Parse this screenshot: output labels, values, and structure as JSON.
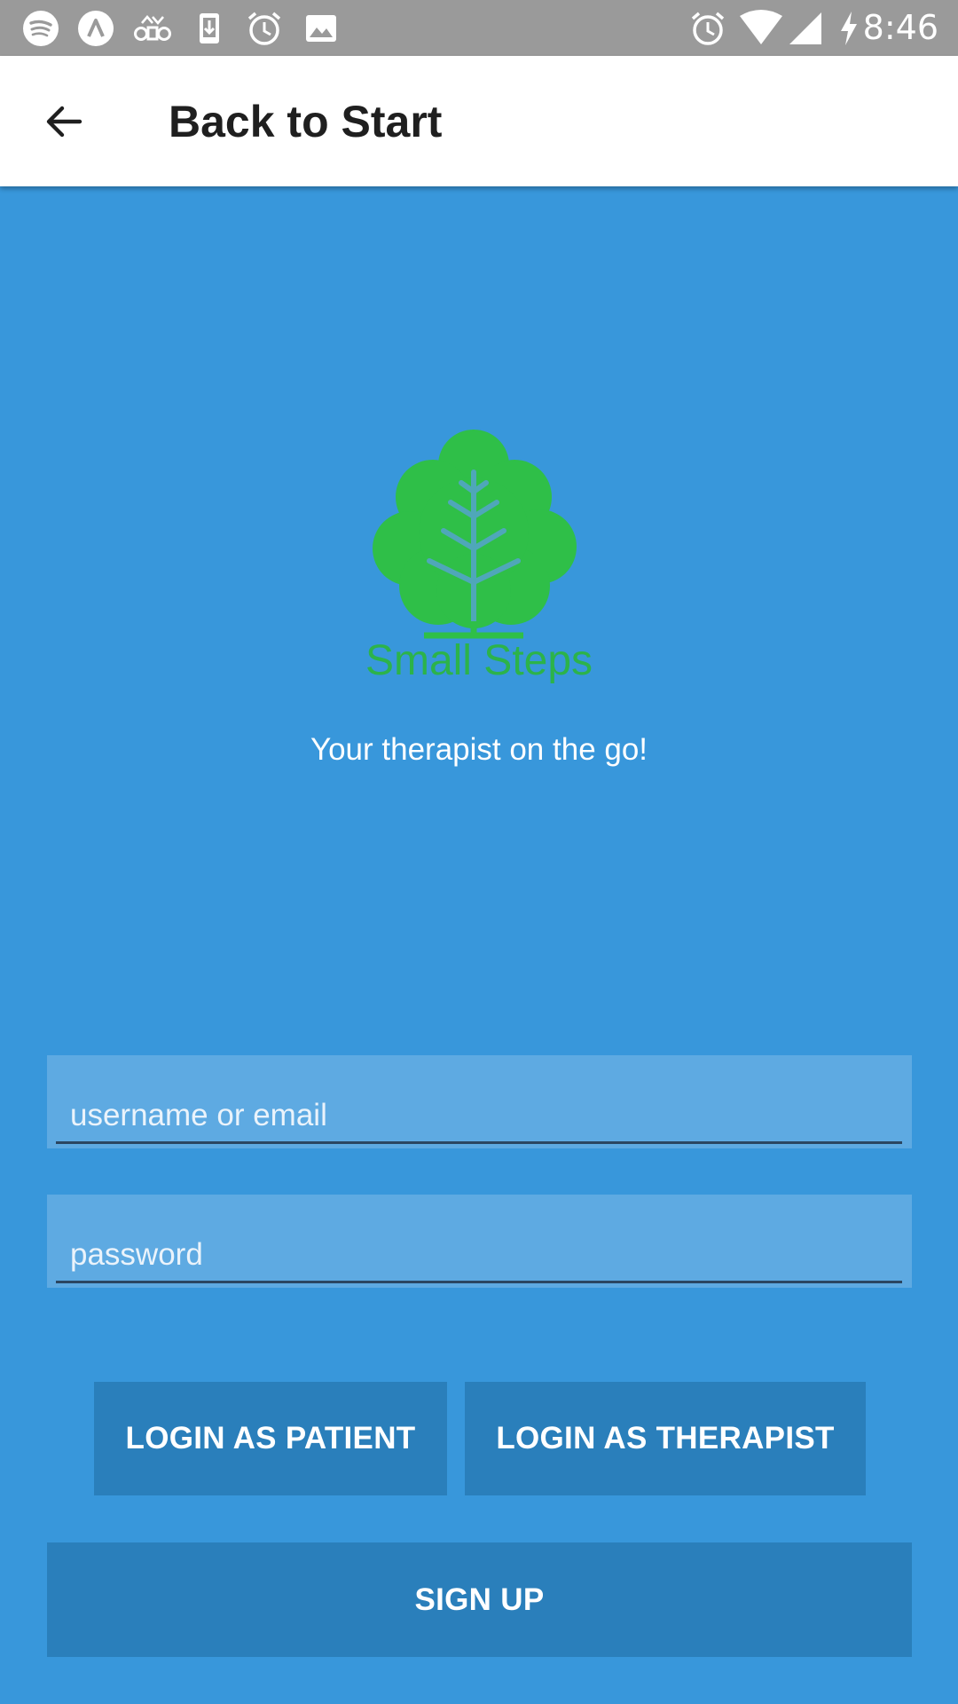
{
  "status_bar": {
    "time": "8:46",
    "left_icons": [
      "spotify-icon",
      "arrival-icon",
      "voicemail-icon",
      "download-icon",
      "alarm-icon",
      "image-icon"
    ],
    "right_icons": [
      "alarm-icon",
      "wifi-icon",
      "signal-icon",
      "charging-icon"
    ]
  },
  "app_bar": {
    "back_icon": "arrow-left-icon",
    "title": "Back to Start"
  },
  "logo": {
    "text": "Small Steps",
    "tree_color": "#2fbf48"
  },
  "tagline": "Your therapist on the go!",
  "form": {
    "username_placeholder": "username or email",
    "username_value": "",
    "password_placeholder": "password",
    "password_value": ""
  },
  "buttons": {
    "login_patient": "LOGIN AS PATIENT",
    "login_therapist": "LOGIN AS THERAPIST",
    "sign_up": "SIGN UP"
  },
  "colors": {
    "background": "#3897db",
    "button": "#2a7fbb",
    "field": "#5eaae2",
    "status_bar": "#9a9a9a"
  }
}
